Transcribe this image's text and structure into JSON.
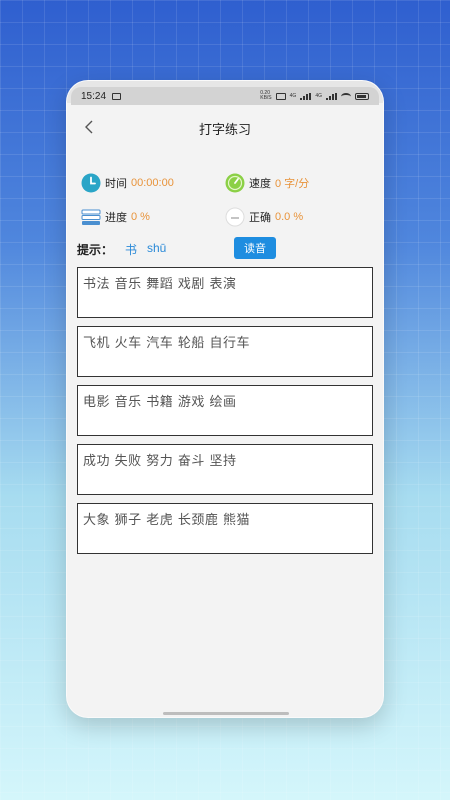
{
  "status": {
    "time": "15:24",
    "net_label_top": "0.20",
    "net_label_bottom": "KB/S",
    "sig1_label": "4G",
    "sig2_label": "4G"
  },
  "header": {
    "title": "打字练习"
  },
  "stats": {
    "time_label": "时间",
    "time_value": "00:00:00",
    "speed_label": "速度",
    "speed_value": "0 字/分",
    "progress_label": "进度",
    "progress_value": "0 %",
    "accuracy_label": "正确",
    "accuracy_value": "0.0 %"
  },
  "hint": {
    "label": "提示：",
    "char": "书",
    "pinyin": "shū",
    "read_button": "读音"
  },
  "word_boxes": [
    "书法 音乐 舞蹈 戏剧 表演",
    "飞机 火车 汽车 轮船 自行车",
    "电影 音乐 书籍 游戏 绘画",
    "成功 失败 努力 奋斗 坚持",
    "大象 狮子 老虎 长颈鹿 熊猫"
  ],
  "colors": {
    "accent": "#1e8de0",
    "value": "#e8933a",
    "clock_icon": "#2aa5c7",
    "speed_icon": "#8bd046"
  }
}
